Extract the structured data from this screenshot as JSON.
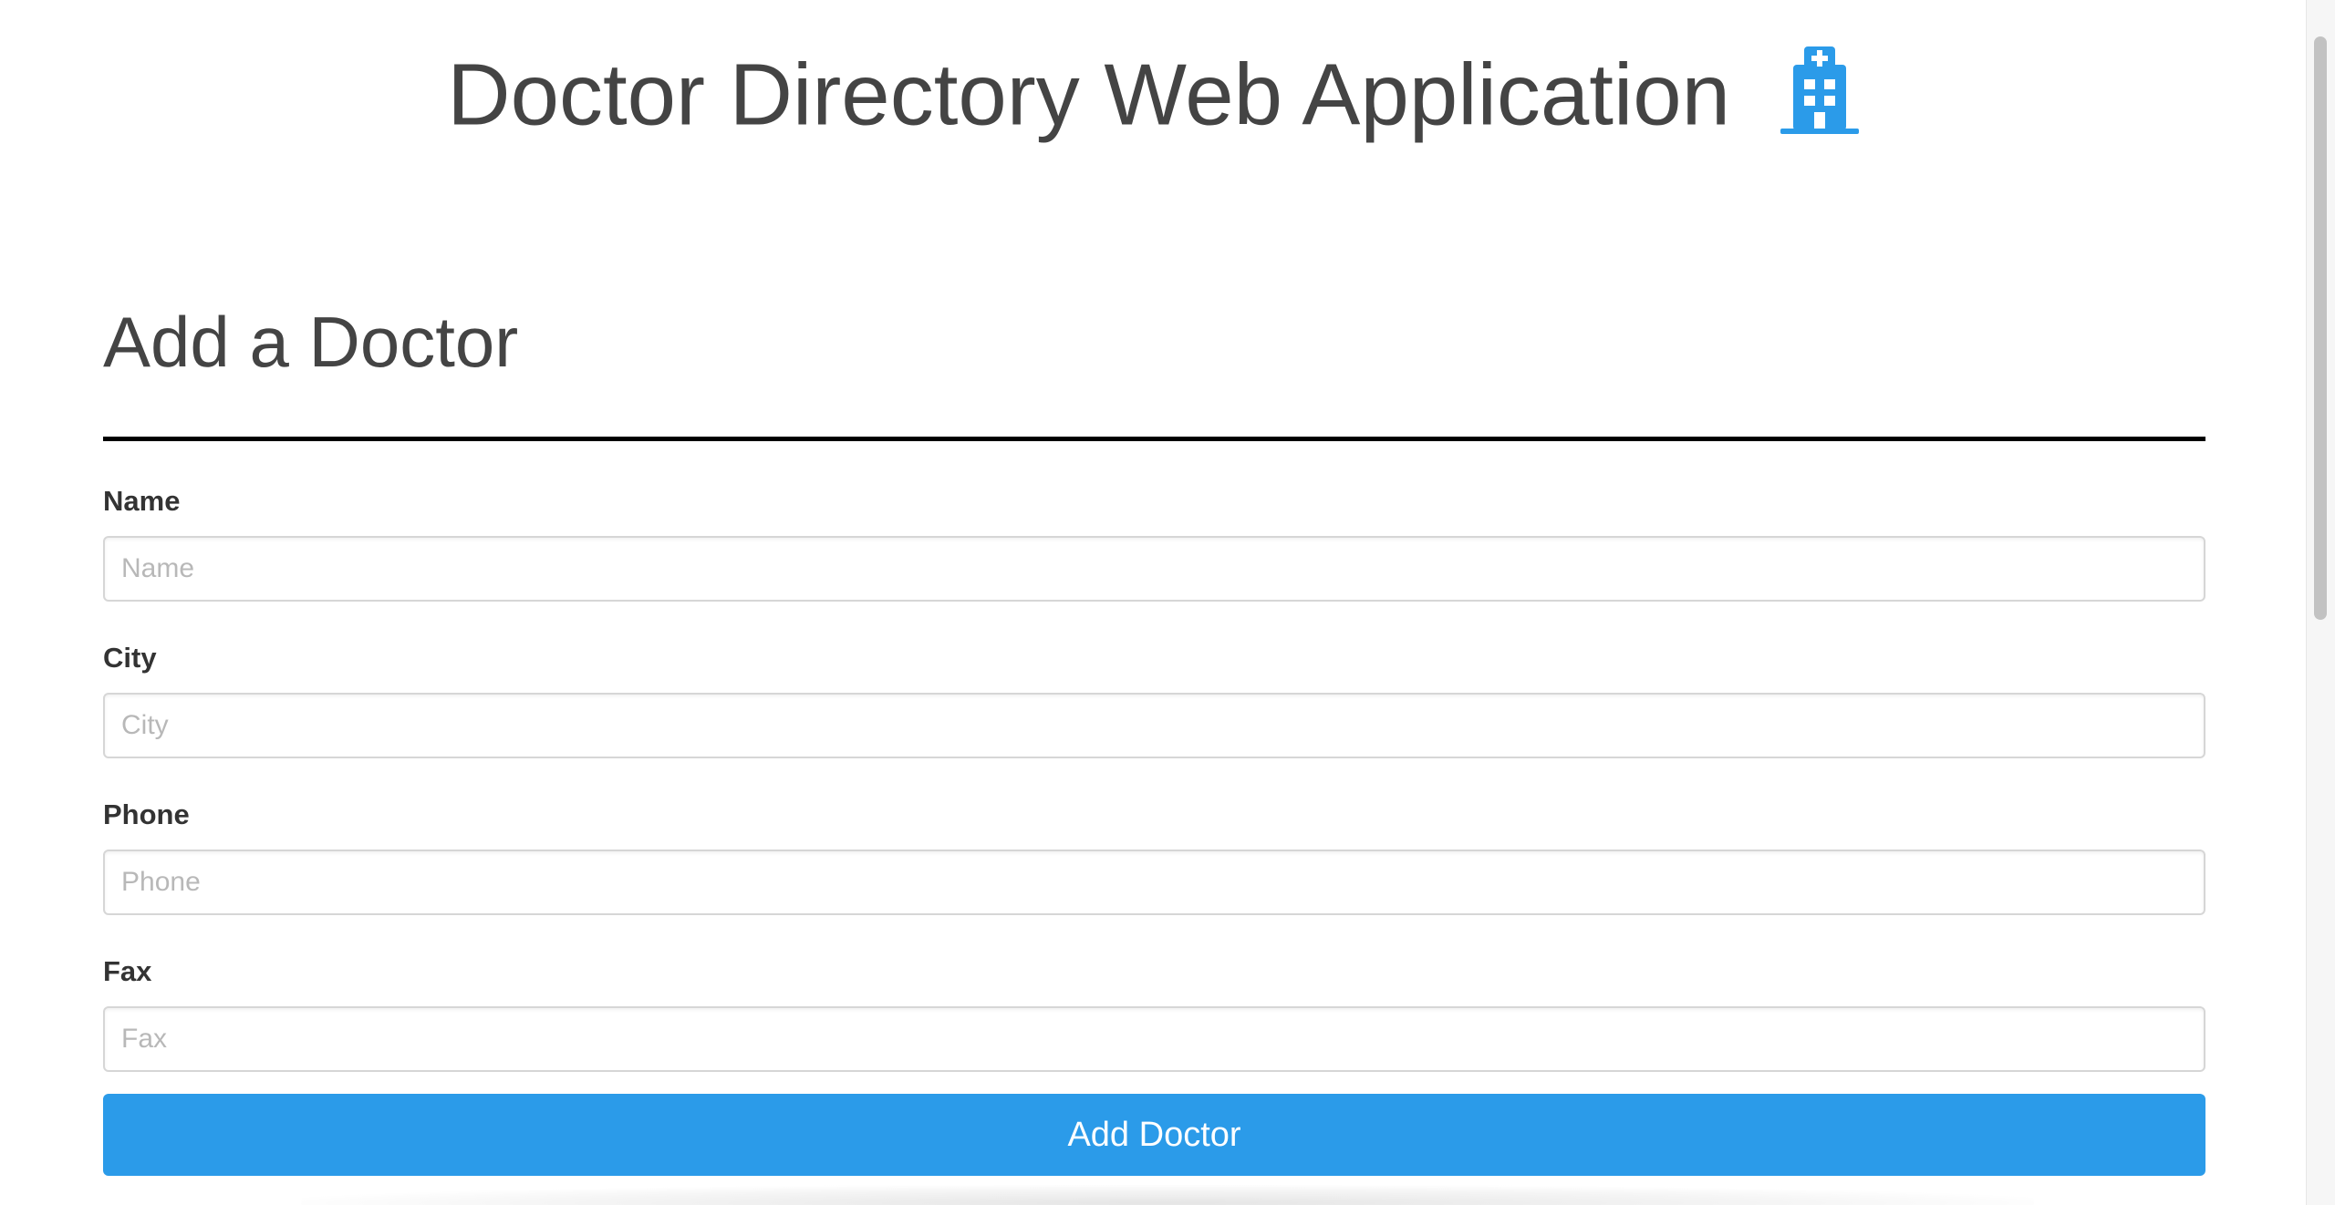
{
  "header": {
    "title": "Doctor Directory Web Application",
    "icon": "hospital-icon",
    "icon_color": "#2b9be9"
  },
  "form": {
    "title": "Add a Doctor",
    "fields": [
      {
        "label": "Name",
        "placeholder": "Name",
        "value": ""
      },
      {
        "label": "City",
        "placeholder": "City",
        "value": ""
      },
      {
        "label": "Phone",
        "placeholder": "Phone",
        "value": ""
      },
      {
        "label": "Fax",
        "placeholder": "Fax",
        "value": ""
      }
    ],
    "submit_label": "Add Doctor",
    "submit_color": "#2b9be9"
  },
  "scrollbar": {
    "position_fraction": 0.0
  }
}
